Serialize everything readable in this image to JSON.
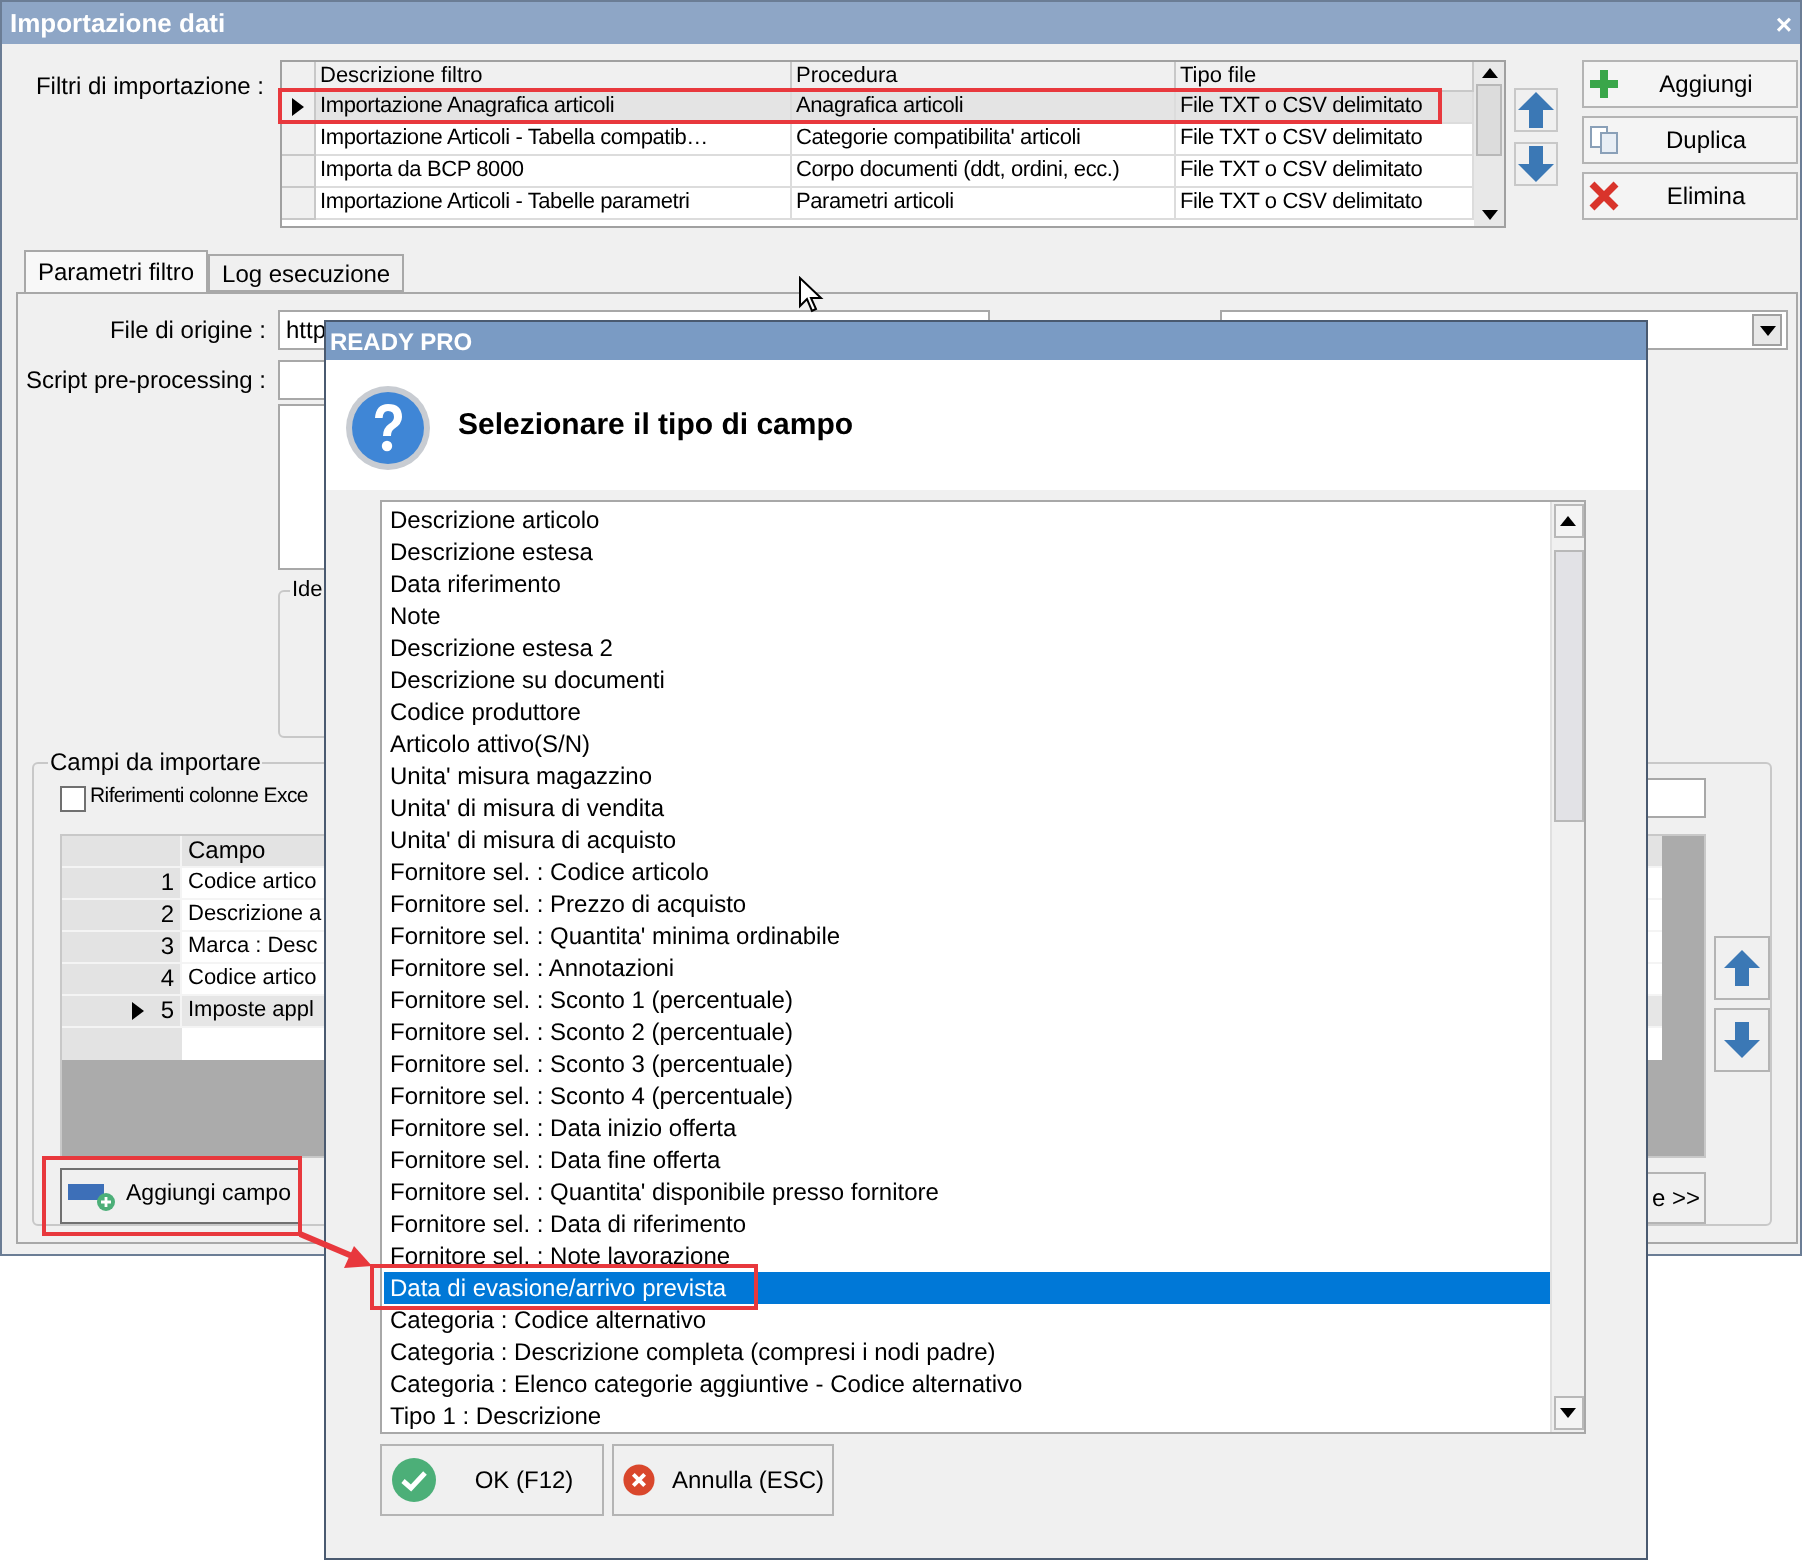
{
  "window": {
    "title": "Importazione dati",
    "close": "×"
  },
  "filters": {
    "label": "Filtri di importazione :",
    "columns": [
      "Descrizione filtro",
      "Procedura",
      "Tipo file"
    ],
    "rows": [
      {
        "cells": [
          "Importazione Anagrafica articoli",
          "Anagrafica articoli",
          "File TXT o CSV delimitato"
        ],
        "selected": true
      },
      {
        "cells": [
          "Importazione Articoli - Tabella compatib…",
          "Categorie compatibilita' articoli",
          "File TXT o CSV delimitato"
        ],
        "selected": false
      },
      {
        "cells": [
          "Importa da BCP 8000",
          "Corpo documenti (ddt, ordini, ecc.)",
          "File TXT o CSV delimitato"
        ],
        "selected": false
      },
      {
        "cells": [
          "Importazione Articoli - Tabelle parametri",
          "Parametri articoli",
          "File TXT o CSV delimitato"
        ],
        "selected": false
      }
    ]
  },
  "filter_buttons": [
    {
      "kind": "add",
      "label": "Aggiungi"
    },
    {
      "kind": "duplicate",
      "label": "Duplica"
    },
    {
      "kind": "delete",
      "label": "Elimina"
    }
  ],
  "tabs": [
    {
      "label": "Parametri filtro",
      "selected": true
    },
    {
      "label": "Log esecuzione",
      "selected": false
    }
  ],
  "params": {
    "file_label": "File di origine :",
    "file_value": "http",
    "script_label": "Script pre-processing :",
    "group_label": "Ide"
  },
  "fields_group": {
    "title": "Campi da importare",
    "checkbox": {
      "label": "Riferimenti colonne Exce",
      "checked": false
    },
    "column": "Campo",
    "rows": [
      {
        "index": "1",
        "field": "Codice artico",
        "selected": false
      },
      {
        "index": "2",
        "field": "Descrizione a",
        "selected": false
      },
      {
        "index": "3",
        "field": "Marca : Desc",
        "selected": false
      },
      {
        "index": "4",
        "field": "Codice artico",
        "selected": false
      },
      {
        "index": "5",
        "field": "Imposte appl",
        "selected": true
      }
    ],
    "add_button": "Aggiungi campo",
    "next_button": "e >>"
  },
  "dialog": {
    "title": "READY PRO",
    "heading": "Selezionare il tipo di campo",
    "items": [
      {
        "label": "Descrizione articolo",
        "selected": false
      },
      {
        "label": "Descrizione estesa",
        "selected": false
      },
      {
        "label": "Data riferimento",
        "selected": false
      },
      {
        "label": "Note",
        "selected": false
      },
      {
        "label": "Descrizione estesa 2",
        "selected": false
      },
      {
        "label": "Descrizione su documenti",
        "selected": false
      },
      {
        "label": "Codice produttore",
        "selected": false
      },
      {
        "label": "Articolo attivo(S/N)",
        "selected": false
      },
      {
        "label": "Unita' misura magazzino",
        "selected": false
      },
      {
        "label": "Unita' di misura di vendita",
        "selected": false
      },
      {
        "label": "Unita' di misura di acquisto",
        "selected": false
      },
      {
        "label": "Fornitore sel. : Codice articolo",
        "selected": false
      },
      {
        "label": "Fornitore sel. : Prezzo di acquisto",
        "selected": false
      },
      {
        "label": "Fornitore sel. : Quantita' minima ordinabile",
        "selected": false
      },
      {
        "label": "Fornitore sel. : Annotazioni",
        "selected": false
      },
      {
        "label": "Fornitore sel. : Sconto 1 (percentuale)",
        "selected": false
      },
      {
        "label": "Fornitore sel. : Sconto 2 (percentuale)",
        "selected": false
      },
      {
        "label": "Fornitore sel. : Sconto 3 (percentuale)",
        "selected": false
      },
      {
        "label": "Fornitore sel. : Sconto 4 (percentuale)",
        "selected": false
      },
      {
        "label": "Fornitore sel. : Data inizio offerta",
        "selected": false
      },
      {
        "label": "Fornitore sel. : Data fine offerta",
        "selected": false
      },
      {
        "label": "Fornitore sel. : Quantita' disponibile presso fornitore",
        "selected": false
      },
      {
        "label": "Fornitore sel. : Data di riferimento",
        "selected": false
      },
      {
        "label": "Fornitore sel. : Note lavorazione",
        "selected": false
      },
      {
        "label": "Data di evasione/arrivo prevista",
        "selected": true
      },
      {
        "label": "Categoria : Codice alternativo",
        "selected": false
      },
      {
        "label": "Categoria : Descrizione completa (compresi i nodi padre)",
        "selected": false
      },
      {
        "label": "Categoria : Elenco categorie aggiuntive - Codice alternativo",
        "selected": false
      },
      {
        "label": "Tipo 1 : Descrizione",
        "selected": false
      }
    ],
    "buttons": [
      {
        "kind": "ok",
        "label": "OK (F12)"
      },
      {
        "kind": "cancel",
        "label": "Annulla (ESC)"
      }
    ]
  }
}
